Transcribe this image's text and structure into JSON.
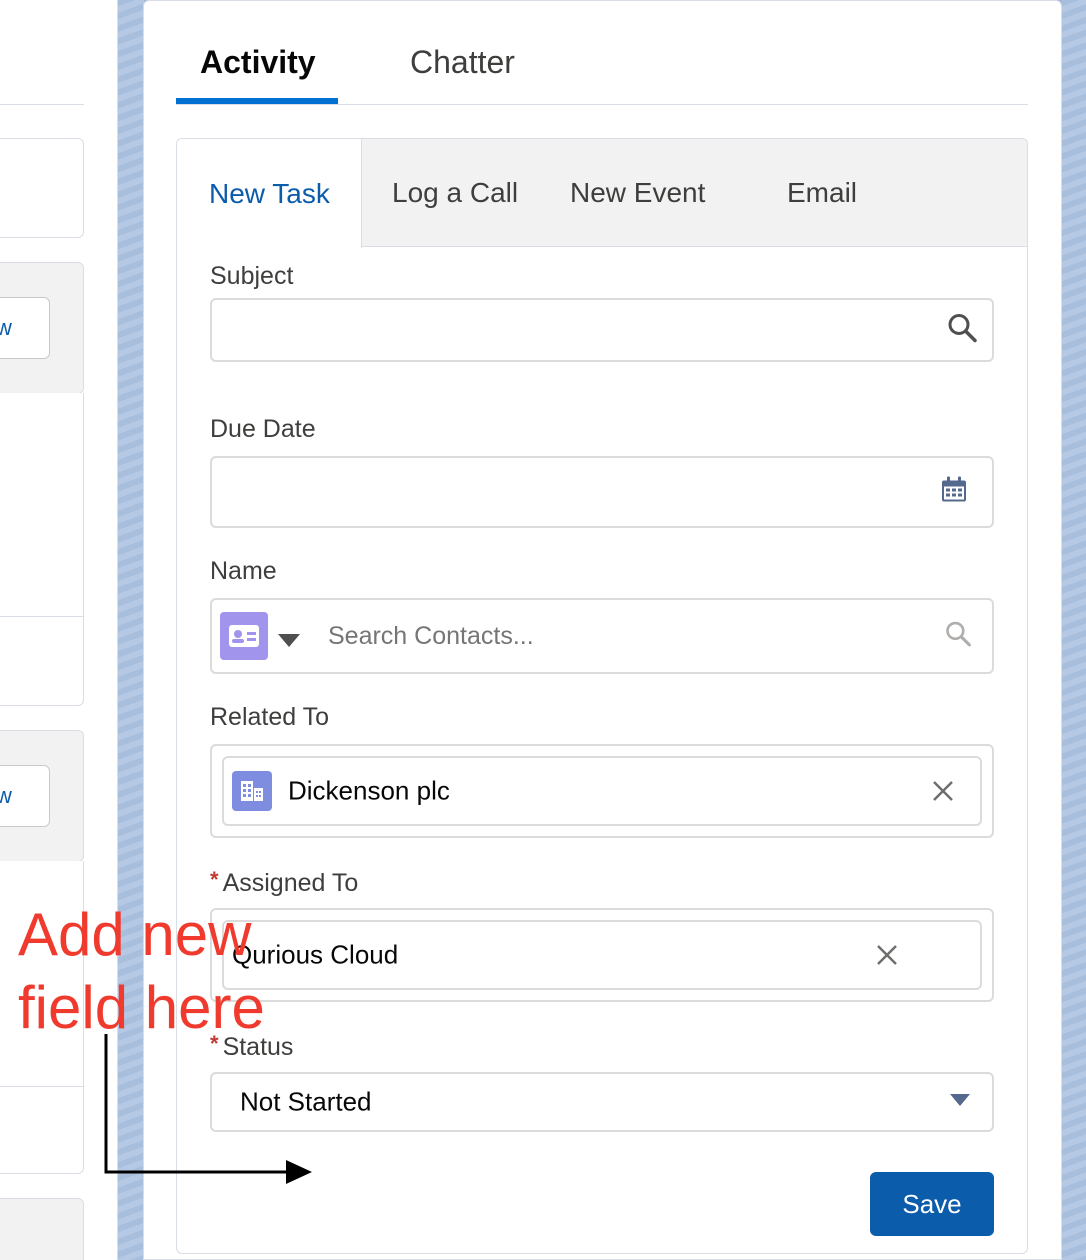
{
  "top_tabs": [
    {
      "label": "Activity",
      "active": true
    },
    {
      "label": "Chatter",
      "active": false
    }
  ],
  "sub_tabs": [
    {
      "label": "New Task",
      "active": true
    },
    {
      "label": "Log a Call",
      "active": false
    },
    {
      "label": "New Event",
      "active": false
    },
    {
      "label": "Email",
      "active": false
    }
  ],
  "form": {
    "subject": {
      "label": "Subject",
      "value": "",
      "icon": "search-icon"
    },
    "due_date": {
      "label": "Due Date",
      "value": "",
      "icon": "calendar-icon"
    },
    "name": {
      "label": "Name",
      "placeholder": "Search Contacts...",
      "object_icon": "contact-icon",
      "icon": "search-icon"
    },
    "related_to": {
      "label": "Related To",
      "value": "Dickenson plc",
      "object_icon": "account-icon"
    },
    "assigned_to": {
      "label": "Assigned To",
      "required_mark": "*",
      "value": "Qurious Cloud"
    },
    "status": {
      "label": "Status",
      "required_mark": "*",
      "value": "Not Started"
    }
  },
  "save_label": "Save",
  "left_panel": {
    "button_fragment": "w"
  },
  "annotation": {
    "line1": "Add new",
    "line2": "field here",
    "color": "#f03a2e"
  },
  "colors": {
    "brand_blue": "#0b5cab",
    "active_tab_underline": "#0070d2",
    "required": "#c23934"
  }
}
